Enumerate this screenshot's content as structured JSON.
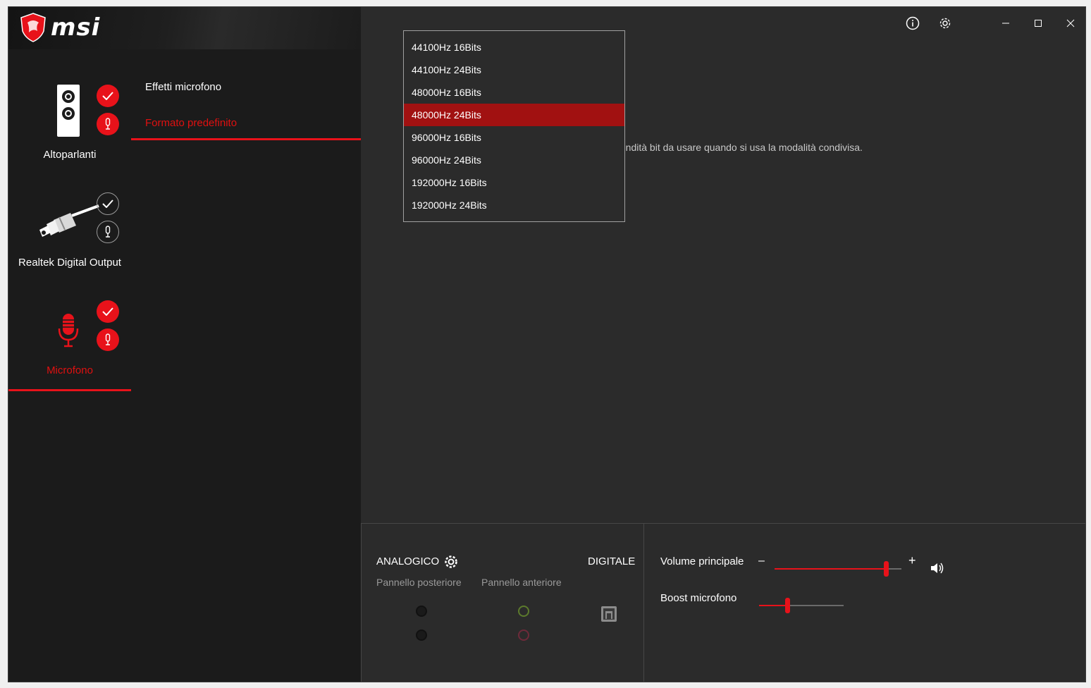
{
  "app": {
    "brand": "msi",
    "accent": "#e8121a"
  },
  "devices": [
    {
      "label": "Altoparlanti",
      "icon": "speaker-icon",
      "default": true,
      "comm_default": true
    },
    {
      "label": "Realtek Digital Output",
      "icon": "audio-cable-icon",
      "default": false,
      "comm_default": false
    },
    {
      "label": "Microfono",
      "icon": "microphone-icon",
      "default": true,
      "comm_default": true,
      "active": true
    }
  ],
  "tabs": [
    {
      "label": "Effetti microfono",
      "active": false
    },
    {
      "label": "Formato predefinito",
      "active": true
    }
  ],
  "main": {
    "description_visible": "fondità bit da usare quando si usa la modalità condivisa."
  },
  "format_dropdown": {
    "options": [
      "44100Hz 16Bits",
      "44100Hz 24Bits",
      "48000Hz 16Bits",
      "48000Hz 24Bits",
      "96000Hz 16Bits",
      "96000Hz 24Bits",
      "192000Hz 16Bits",
      "192000Hz 24Bits"
    ],
    "selected": "48000Hz 24Bits"
  },
  "connectors": {
    "analog_label": "ANALOGICO",
    "digital_label": "DIGITALE",
    "rear_panel": "Pannello posteriore",
    "front_panel": "Pannello anteriore"
  },
  "volume": {
    "main_label": "Volume principale",
    "main_level": 0.88,
    "boost_label": "Boost microfono",
    "boost_level": 0.33
  }
}
